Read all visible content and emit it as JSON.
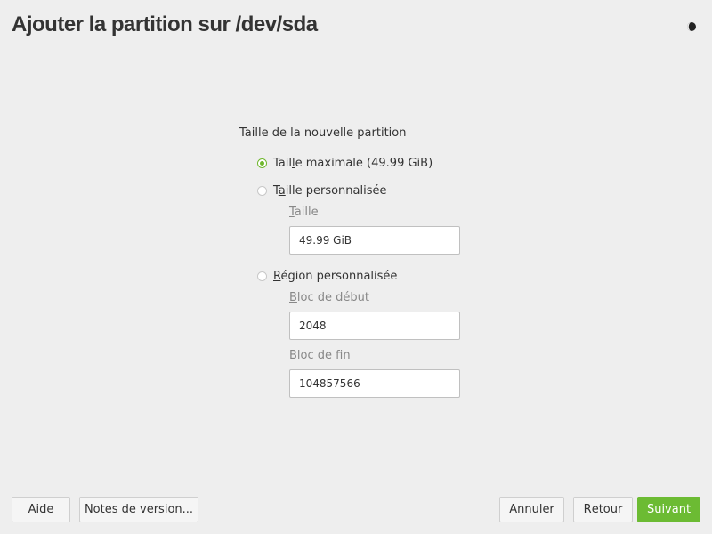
{
  "header": {
    "title": "Ajouter la partition sur /dev/sda",
    "theme_icon": "half-moon-icon"
  },
  "form": {
    "section_label": "Taille de la nouvelle partition",
    "options": [
      {
        "pre": "Tail",
        "mnemonic": "l",
        "post": "e maximale (49.99 GiB)",
        "checked": true
      },
      {
        "pre": "T",
        "mnemonic": "a",
        "post": "ille personnalisée",
        "checked": false
      },
      {
        "pre": "",
        "mnemonic": "R",
        "post": "égion personnalisée",
        "checked": false
      }
    ],
    "size_label": {
      "mnemonic": "T",
      "post": "aille"
    },
    "size_value": "49.99 GiB",
    "start_label": {
      "mnemonic": "B",
      "post": "loc de début"
    },
    "start_value": "2048",
    "end_label": {
      "mnemonic": "B",
      "post": "loc de fin"
    },
    "end_value": "104857566"
  },
  "footer": {
    "help": {
      "pre": "Ai",
      "mnemonic": "d",
      "post": "e"
    },
    "release_notes": {
      "pre": "N",
      "mnemonic": "o",
      "post": "tes de version..."
    },
    "cancel": {
      "pre": "",
      "mnemonic": "A",
      "post": "nnuler"
    },
    "back": {
      "pre": "",
      "mnemonic": "R",
      "post": "etour"
    },
    "next": {
      "pre": "",
      "mnemonic": "S",
      "post": "uivant"
    }
  },
  "colors": {
    "accent": "#6cbb33",
    "background": "#eeeeee"
  }
}
